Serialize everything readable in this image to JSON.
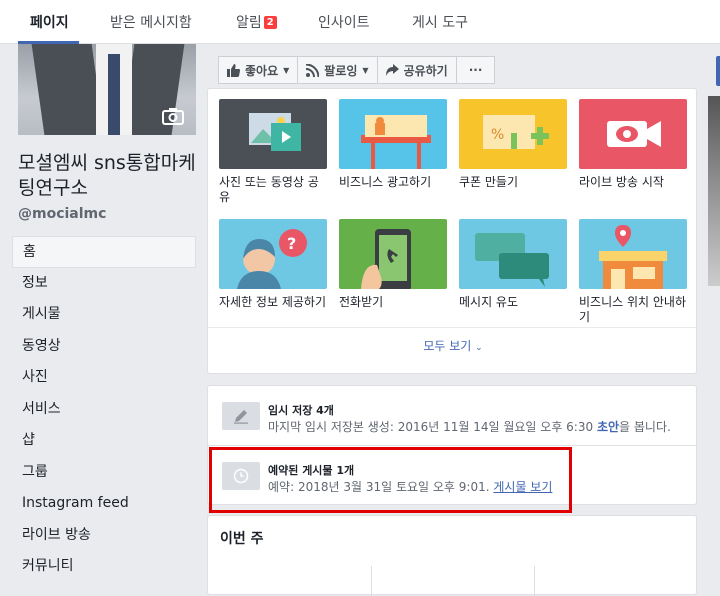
{
  "topnav": {
    "tabs": [
      {
        "label": "페이지"
      },
      {
        "label": "받은 메시지함"
      },
      {
        "label": "알림",
        "badge": "2"
      },
      {
        "label": "인사이트"
      },
      {
        "label": "게시 도구"
      }
    ]
  },
  "page": {
    "name": "모셜엠씨 sns통합마케팅연구소",
    "handle": "@mocialmc"
  },
  "leftnav": {
    "items": [
      "홈",
      "정보",
      "게시물",
      "동영상",
      "사진",
      "서비스",
      "샵",
      "그룹",
      "Instagram feed",
      "라이브 방송",
      "커뮤니티"
    ]
  },
  "actions": {
    "like": "좋아요",
    "follow": "팔로잉",
    "share": "공유하기",
    "more": "···"
  },
  "tools": {
    "tiles": [
      {
        "label": "사진 또는 동영상 공유",
        "color": "#4b4f56"
      },
      {
        "label": "비즈니스 광고하기",
        "color": "#56c4e8"
      },
      {
        "label": "쿠폰 만들기",
        "color": "#f7c52b"
      },
      {
        "label": "라이브 방송 시작",
        "color": "#e95665"
      },
      {
        "label": "자세한 정보 제공하기",
        "color": "#6fc8e3"
      },
      {
        "label": "전화받기",
        "color": "#66b04a"
      },
      {
        "label": "메시지 유도",
        "color": "#6fc8e3"
      },
      {
        "label": "비즈니스 위치 안내하기",
        "color": "#6fc8e3"
      }
    ],
    "see_all": "모두 보기"
  },
  "drafts": {
    "title": "임시 저장 4개",
    "detail": "마지막 임시 저장본 생성: 2016년 11월 14일 월요일 오후 6:30 ",
    "link": "초안",
    "suffix": "을 봅니다."
  },
  "scheduled": {
    "title": "예약된 게시물 1개",
    "detail": "예약: 2018년 3월 31일 토요일 오후 9:01. ",
    "link": "게시물 보기"
  },
  "this_week": {
    "title": "이번 주"
  }
}
